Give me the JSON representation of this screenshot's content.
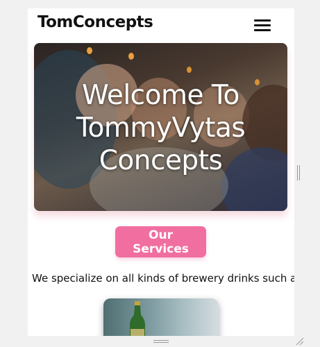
{
  "header": {
    "logo": "TomConcepts",
    "menu_icon": "hamburger-menu-icon"
  },
  "hero": {
    "line1": "Welcome To",
    "line2": "TommyVytas",
    "line3": "Concepts",
    "image": "people-toasting-drinks-photo"
  },
  "services": {
    "button_label": "Our Services",
    "description": "We specialize on all kinds of brewery drinks such as"
  },
  "product": {
    "image": "beer-bottle-photo"
  },
  "colors": {
    "accent": "#f06fa0",
    "text": "#111111",
    "background": "#f1f1f1"
  }
}
